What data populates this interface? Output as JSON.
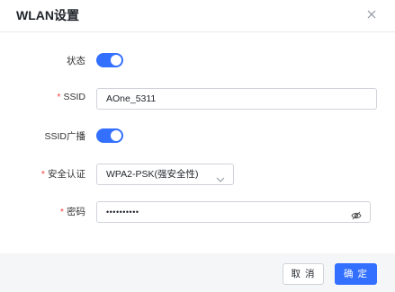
{
  "dialog": {
    "title": "WLAN设置",
    "close_icon": "close-icon"
  },
  "form": {
    "status": {
      "label": "状态",
      "enabled": true
    },
    "ssid": {
      "required_mark": "*",
      "label": "SSID",
      "value": "AOne_5311"
    },
    "ssid_broadcast": {
      "label": "SSID广播",
      "enabled": true
    },
    "security": {
      "required_mark": "*",
      "label": "安全认证",
      "value": "WPA2-PSK(强安全性)",
      "icon": "chevron-down-icon"
    },
    "password": {
      "required_mark": "*",
      "label": "密码",
      "value": "••••••••••",
      "icon": "eye-icon"
    }
  },
  "footer": {
    "cancel_label": "取 消",
    "confirm_label": "确 定"
  },
  "colors": {
    "accent": "#3370ff",
    "required": "#f53f3f",
    "footer_bg": "#f5f6f8"
  }
}
